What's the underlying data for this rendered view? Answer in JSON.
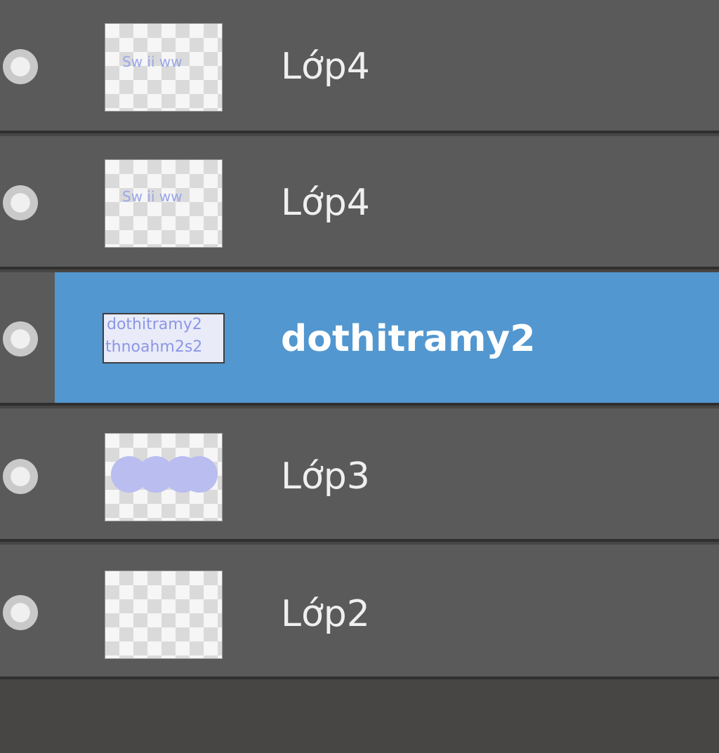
{
  "layers": [
    {
      "name": "Lớp4",
      "selected": false,
      "thumbnail": "text-faint"
    },
    {
      "name": "Lớp4",
      "selected": false,
      "thumbnail": "text-faint"
    },
    {
      "name": "dothitramy2",
      "selected": true,
      "thumbnail": "text-box"
    },
    {
      "name": "Lớp3",
      "selected": false,
      "thumbnail": "blobs"
    },
    {
      "name": "Lớp2",
      "selected": false,
      "thumbnail": "empty"
    }
  ],
  "thumbnail_text": {
    "faint_1": "Sw ii ww",
    "faint_2": "Sw ii ww",
    "box_line1": "dothitramy2",
    "box_line2": "thnoahm2s2"
  },
  "colors": {
    "row_bg": "#5a5a5a",
    "selected_bg": "#5297d0",
    "separator": "#2f2f2f",
    "panel_bg": "#474645"
  }
}
